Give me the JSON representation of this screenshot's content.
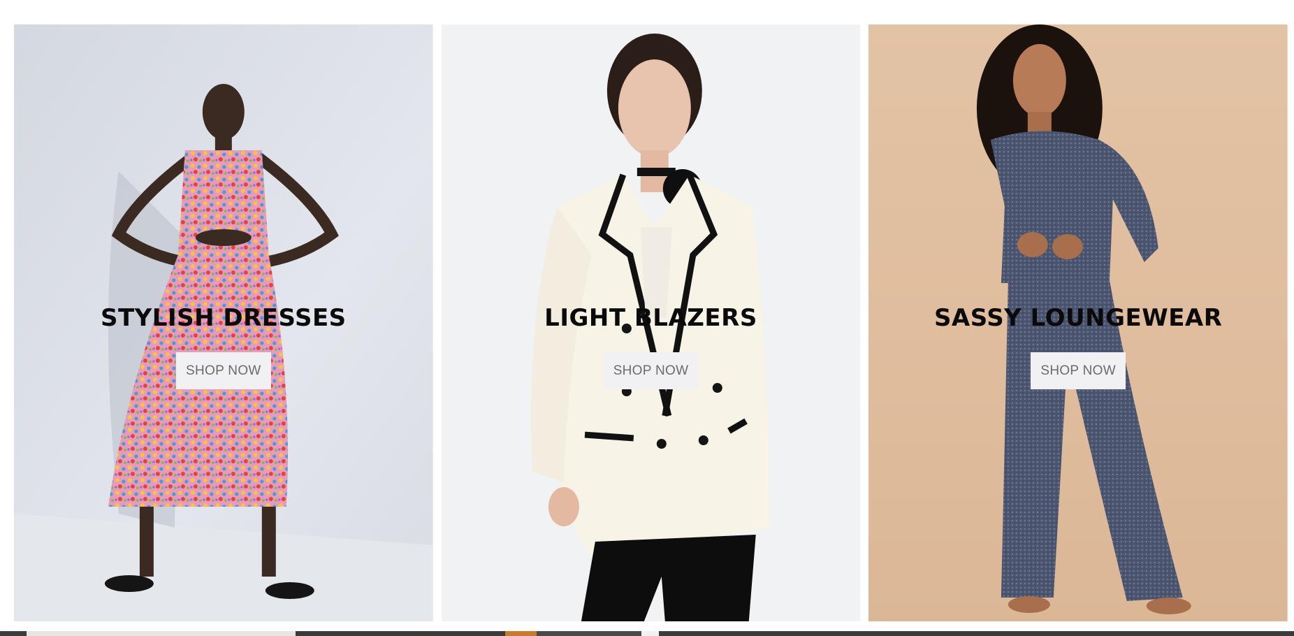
{
  "cards": [
    {
      "title": "STYLISH DRESSES",
      "button_label": "SHOP NOW",
      "photo_subject": "model in floral cut-out midi dress",
      "bg_color": "#dde0e7"
    },
    {
      "title": "LIGHT BLAZERS",
      "button_label": "SHOP NOW",
      "photo_subject": "model in cream tweed blazer with black trim",
      "bg_color": "#eceef0"
    },
    {
      "title": "SASSY LOUNGEWEAR",
      "button_label": "SHOP NOW",
      "photo_subject": "model in grey knit loungewear set",
      "bg_color": "#e2c3a5"
    }
  ],
  "colors": {
    "title_text": "#0a0a0a",
    "button_bg": "#f1f1f3",
    "button_text": "#6b6b6b",
    "page_bg": "#ffffff"
  }
}
